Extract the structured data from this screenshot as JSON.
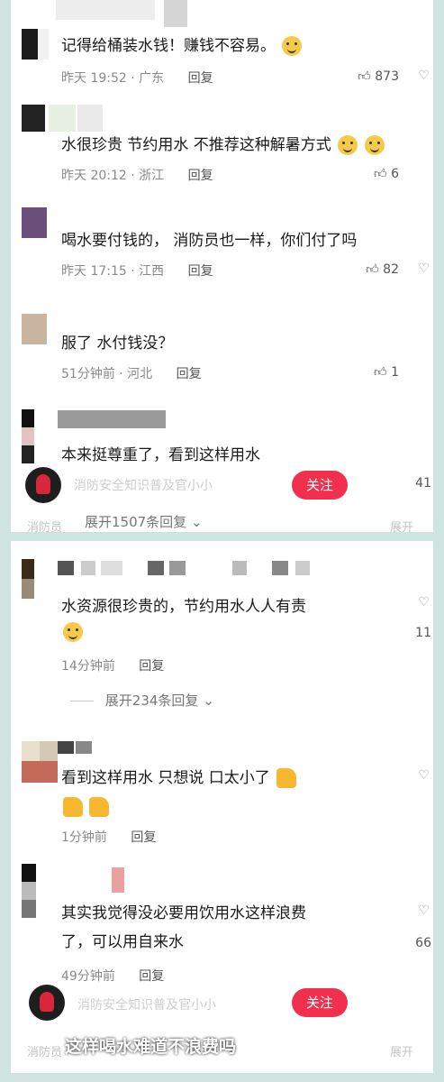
{
  "panel1": {
    "comments": [
      {
        "text": "记得给桶装水钱！赚钱不容易。",
        "time": "昨天 19:52 · 广东",
        "reply": "回复",
        "likes": "873"
      },
      {
        "text": "水很珍贵 节约用水 不推荐这种解暑方式",
        "time": "昨天 20:12 · 浙江",
        "reply": "回复",
        "likes": "6"
      },
      {
        "text": "喝水要付钱的， 消防员也一样，你们付了吗",
        "time": "昨天 17:15 · 江西",
        "reply": "回复",
        "likes": "82"
      },
      {
        "text": "服了 水付钱没？",
        "time": "51分钟前 · 河北",
        "reply": "回复",
        "likes": "1"
      },
      {
        "text": "本来挺尊重了，看到这样用水",
        "likes": "41"
      }
    ],
    "account_overlay": "消防安全知识普及官小小",
    "follow": "关注",
    "expand": "展开1507条回复",
    "bottom_overlay_left": "消防员",
    "bottom_overlay_right": "展开"
  },
  "panel2": {
    "comments": [
      {
        "text1": "水资源很珍贵的，节约用水人人有责",
        "time": "14分钟前",
        "reply": "回复",
        "likes": "11"
      },
      {
        "text1": "看到这样用水  只想说  口太小了",
        "time": "1分钟前",
        "reply": "回复"
      },
      {
        "text1": "其实我觉得没必要用饮用水这样浪费",
        "text2": "了，可以用自来水",
        "time": "49分钟前",
        "reply": "回复",
        "likes": "66"
      }
    ],
    "expand": "展开234条回复",
    "account_overlay": "消防安全知识普及官小小",
    "follow": "关注",
    "caption": "这样喝水难道不浪费吗",
    "bottom_overlay_left": "消防员",
    "bottom_overlay_right": "展开"
  },
  "colors": {
    "accent": "#f2304e",
    "background": "#cfe3df"
  }
}
